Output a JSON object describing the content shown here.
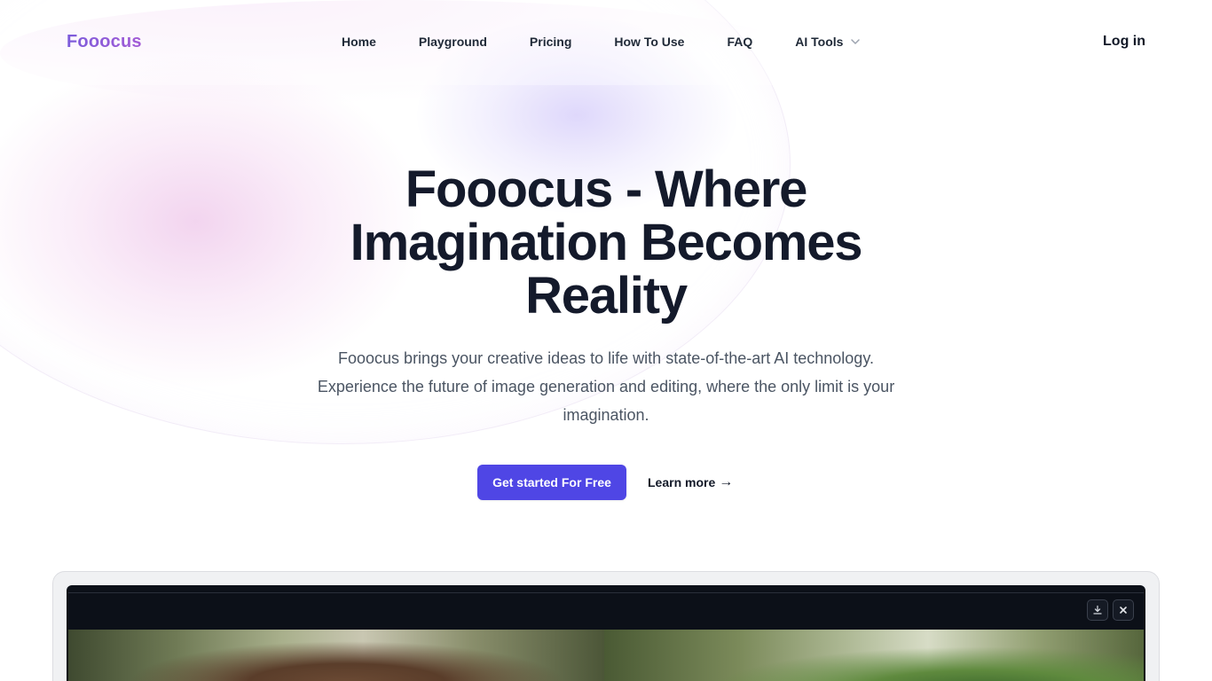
{
  "brand": {
    "logo_text": "Fooocus",
    "accent_color": "#4f46e5",
    "logo_gradient": [
      "#7c5cdb",
      "#a35bd6"
    ]
  },
  "nav": {
    "items": [
      {
        "label": "Home"
      },
      {
        "label": "Playground"
      },
      {
        "label": "Pricing"
      },
      {
        "label": "How To Use"
      },
      {
        "label": "FAQ"
      }
    ],
    "tools_label": "AI Tools",
    "tools_icon": "chevron-down-icon",
    "login_label": "Log in"
  },
  "hero": {
    "title": "Fooocus - Where Imagination Becomes Reality",
    "description": "Fooocus brings your creative ideas to life with state-of-the-art AI technology. Experience the future of image generation and editing, where the only limit is your imagination.",
    "primary_cta": "Get started For Free",
    "secondary_cta": "Learn more",
    "secondary_cta_arrow": "→"
  },
  "preview": {
    "toolbar_icons": [
      "download-icon",
      "close-icon"
    ]
  }
}
